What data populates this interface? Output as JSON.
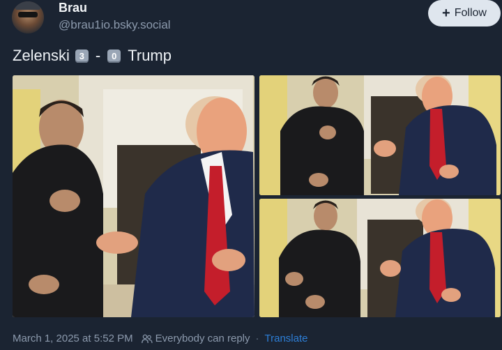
{
  "author": {
    "display_name": "Brau",
    "handle": "@brau1io.bsky.social"
  },
  "follow_button": {
    "label": "Follow",
    "icon": "plus-icon"
  },
  "post": {
    "text_before": "Zelenski",
    "score_left": "3",
    "dash": "-",
    "score_right": "0",
    "text_after": "Trump"
  },
  "images": [
    {
      "name": "post-image-main"
    },
    {
      "name": "post-image-top-right"
    },
    {
      "name": "post-image-bottom-right"
    }
  ],
  "footer": {
    "timestamp": "March 1, 2025 at 5:52 PM",
    "reply_setting": "Everybody can reply",
    "separator": "·",
    "translate": "Translate",
    "reply_icon": "people-icon"
  },
  "colors": {
    "background": "#1b2432",
    "follow_bg": "#dfe6ee",
    "link": "#2d7fd8",
    "muted": "#8c9aad"
  }
}
